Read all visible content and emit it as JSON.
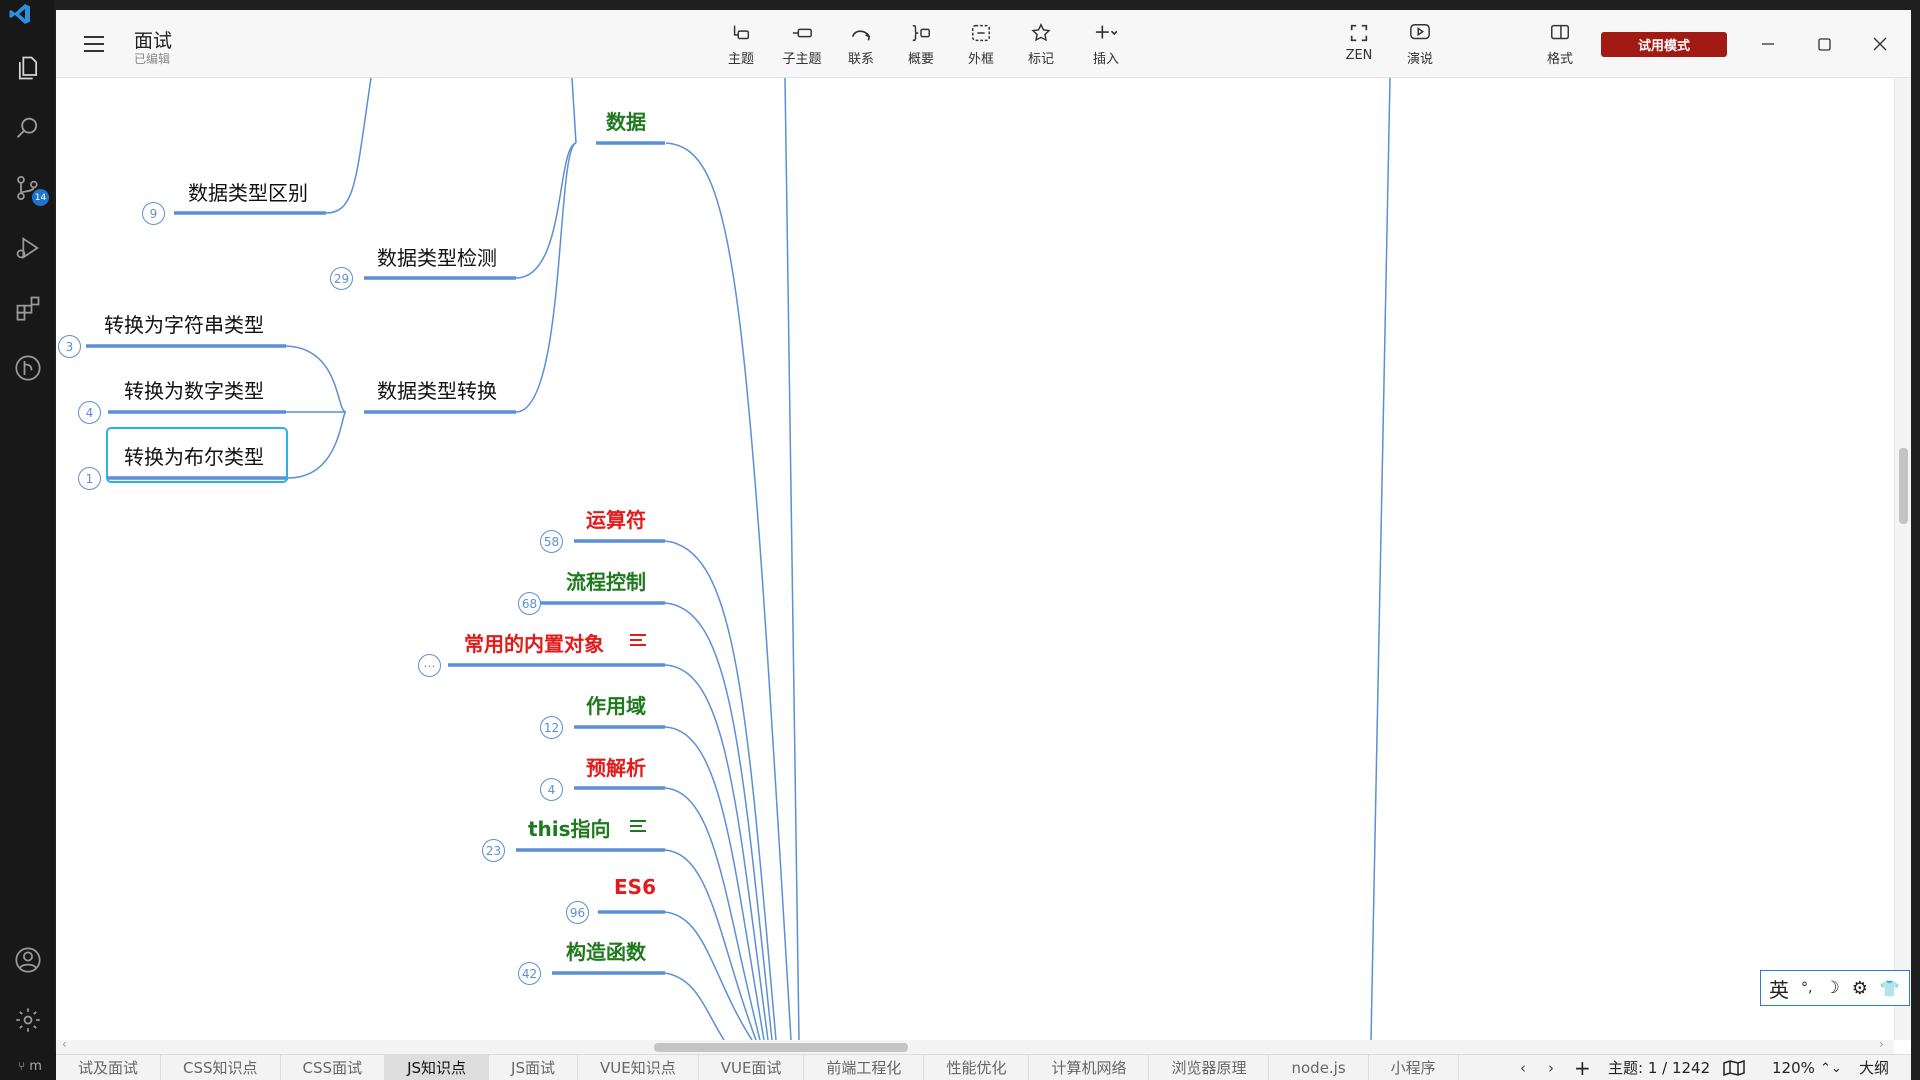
{
  "vscode": {
    "status_text": "m"
  },
  "app": {
    "doc_title": "面试",
    "doc_status": "已编辑",
    "toolbar": [
      {
        "label": "主题",
        "icon": "topic-icon"
      },
      {
        "label": "子主题",
        "icon": "subtopic-icon"
      },
      {
        "label": "联系",
        "icon": "relationship-icon"
      },
      {
        "label": "概要",
        "icon": "summary-icon"
      },
      {
        "label": "外框",
        "icon": "boundary-icon"
      },
      {
        "label": "标记",
        "icon": "marker-star-icon"
      },
      {
        "label": "插入",
        "icon": "insert-plus-icon"
      }
    ],
    "zen_label": "ZEN",
    "present_label": "演说",
    "format_label": "格式",
    "trial_label": "试用模式"
  },
  "mindmap": {
    "nodes": {
      "data": "数据",
      "type_diff": "数据类型区别",
      "type_check": "数据类型检测",
      "to_string": "转换为字符串类型",
      "to_number": "转换为数字类型",
      "type_convert": "数据类型转换",
      "to_boolean": "转换为布尔类型",
      "operators": "运算符",
      "flow_control": "流程控制",
      "builtin_objects": "常用的内置对象",
      "scope": "作用域",
      "preparse": "预解析",
      "this_pointer": "this指向",
      "es6": "ES6",
      "constructor": "构造函数"
    },
    "badges": {
      "type_diff": "9",
      "type_check": "29",
      "to_string": "3",
      "to_number": "4",
      "to_boolean": "1",
      "operators": "58",
      "flow_control": "68",
      "builtin_objects": "⋯",
      "scope": "12",
      "preparse": "4",
      "this_pointer": "23",
      "es6": "96",
      "constructor": "42"
    },
    "colors": {
      "line": "#5b8fd6",
      "green": "#1f7a1f",
      "red": "#e31b1b",
      "selection": "#2ab0ea"
    }
  },
  "bottom": {
    "tabs": [
      "试及面试",
      "CSS知识点",
      "CSS面试",
      "JS知识点",
      "JS面试",
      "VUE知识点",
      "VUE面试",
      "前端工程化",
      "性能优化",
      "计算机网络",
      "浏览器原理",
      "node.js",
      "小程序"
    ],
    "active_tab": "JS知识点",
    "topic_count": "主题: 1 / 1242",
    "zoom": "120%",
    "outline": "大纲"
  },
  "ime": {
    "lang": "英"
  }
}
